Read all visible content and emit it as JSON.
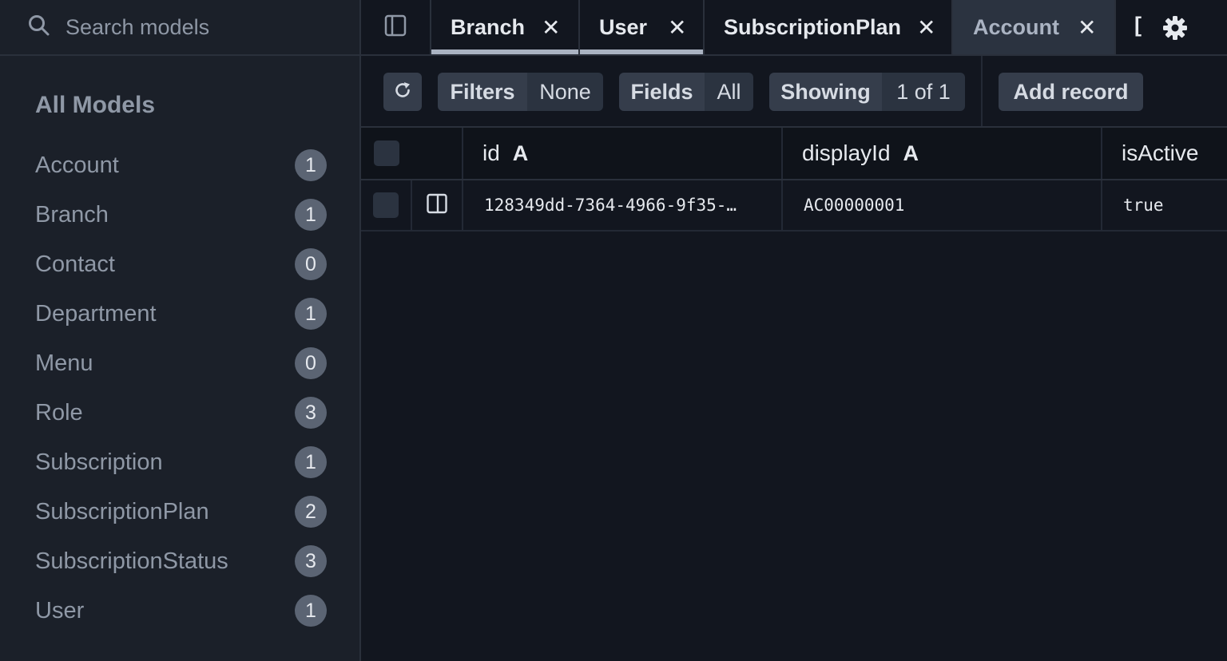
{
  "sidebar": {
    "search_placeholder": "Search models",
    "heading": "All Models",
    "models": [
      {
        "name": "Account",
        "count": "1"
      },
      {
        "name": "Branch",
        "count": "1"
      },
      {
        "name": "Contact",
        "count": "0"
      },
      {
        "name": "Department",
        "count": "1"
      },
      {
        "name": "Menu",
        "count": "0"
      },
      {
        "name": "Role",
        "count": "3"
      },
      {
        "name": "Subscription",
        "count": "1"
      },
      {
        "name": "SubscriptionPlan",
        "count": "2"
      },
      {
        "name": "SubscriptionStatus",
        "count": "3"
      },
      {
        "name": "User",
        "count": "1"
      }
    ]
  },
  "tabs": {
    "items": [
      {
        "label": "Branch",
        "close": "✕"
      },
      {
        "label": "User",
        "close": "✕"
      },
      {
        "label": "SubscriptionPlan",
        "close": "✕"
      },
      {
        "label": "Account",
        "close": "✕"
      }
    ],
    "overflow_label": "["
  },
  "toolbar": {
    "filters_label": "Filters",
    "filters_value": "None",
    "fields_label": "Fields",
    "fields_value": "All",
    "showing_label": "Showing",
    "showing_value": "1 of 1",
    "add_record_label": "Add record"
  },
  "table": {
    "columns": [
      {
        "name": "id",
        "type": "A"
      },
      {
        "name": "displayId",
        "type": "A"
      },
      {
        "name": "isActive",
        "type": ""
      }
    ],
    "rows": [
      {
        "cells": [
          "128349dd-7364-4966-9f35-…",
          "AC00000001",
          "true"
        ]
      }
    ]
  },
  "icons": {
    "search": "search-icon",
    "panel_toggle": "sidebar-toggle-icon",
    "refresh": "refresh-icon",
    "settings": "gear-icon",
    "open_record": "panel-icon"
  },
  "colors": {
    "background": "#12161f",
    "sidebar": "#1b2029",
    "badge": "#5b6473",
    "active_tab": "#2b3340",
    "button": "#353d4b"
  }
}
